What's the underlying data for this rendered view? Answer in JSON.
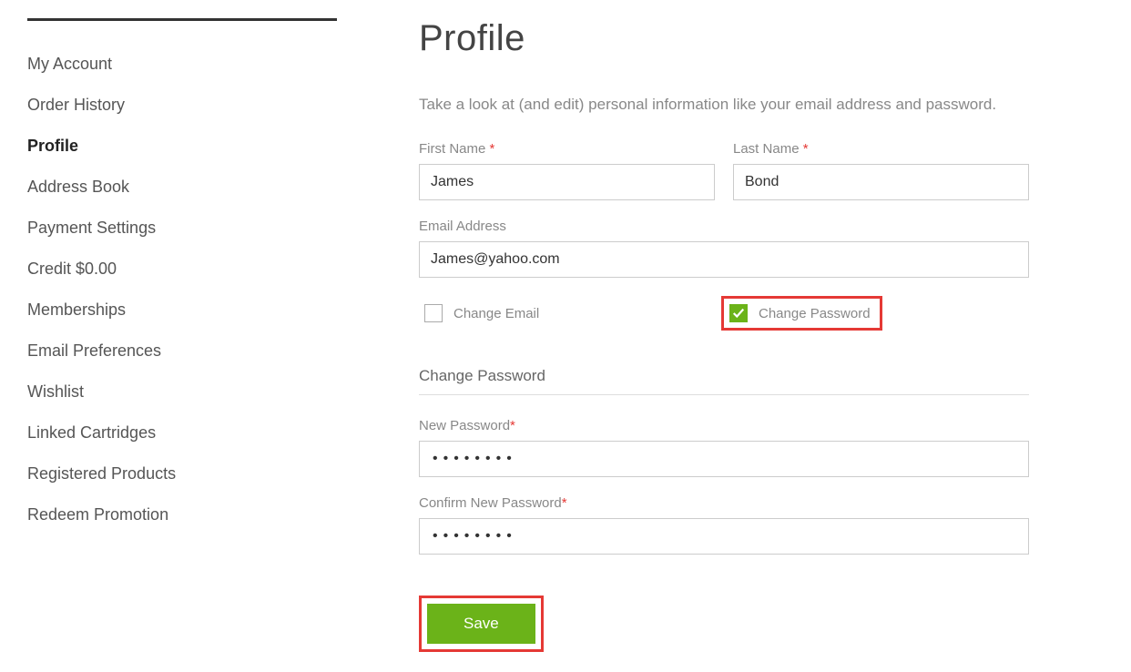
{
  "sidebar": {
    "items": [
      {
        "label": "My Account",
        "active": false
      },
      {
        "label": "Order History",
        "active": false
      },
      {
        "label": "Profile",
        "active": true
      },
      {
        "label": "Address Book",
        "active": false
      },
      {
        "label": "Payment Settings",
        "active": false
      },
      {
        "label": "Credit $0.00",
        "active": false
      },
      {
        "label": "Memberships",
        "active": false
      },
      {
        "label": "Email Preferences",
        "active": false
      },
      {
        "label": "Wishlist",
        "active": false
      },
      {
        "label": "Linked Cartridges",
        "active": false
      },
      {
        "label": "Registered Products",
        "active": false
      },
      {
        "label": "Redeem Promotion",
        "active": false
      }
    ]
  },
  "page": {
    "title": "Profile",
    "description": "Take a look at (and edit) personal information like your email address and password."
  },
  "form": {
    "first_name_label": "First Name",
    "first_name_value": "James",
    "last_name_label": "Last Name",
    "last_name_value": "Bond",
    "email_label": "Email Address",
    "email_value": "James@yahoo.com",
    "change_email_label": "Change Email",
    "change_email_checked": false,
    "change_password_label": "Change Password",
    "change_password_checked": true,
    "change_password_section": "Change Password",
    "new_password_label": "New Password",
    "new_password_value": "••••••••",
    "confirm_password_label": "Confirm New Password",
    "confirm_password_value": "••••••••",
    "save_label": "Save"
  }
}
